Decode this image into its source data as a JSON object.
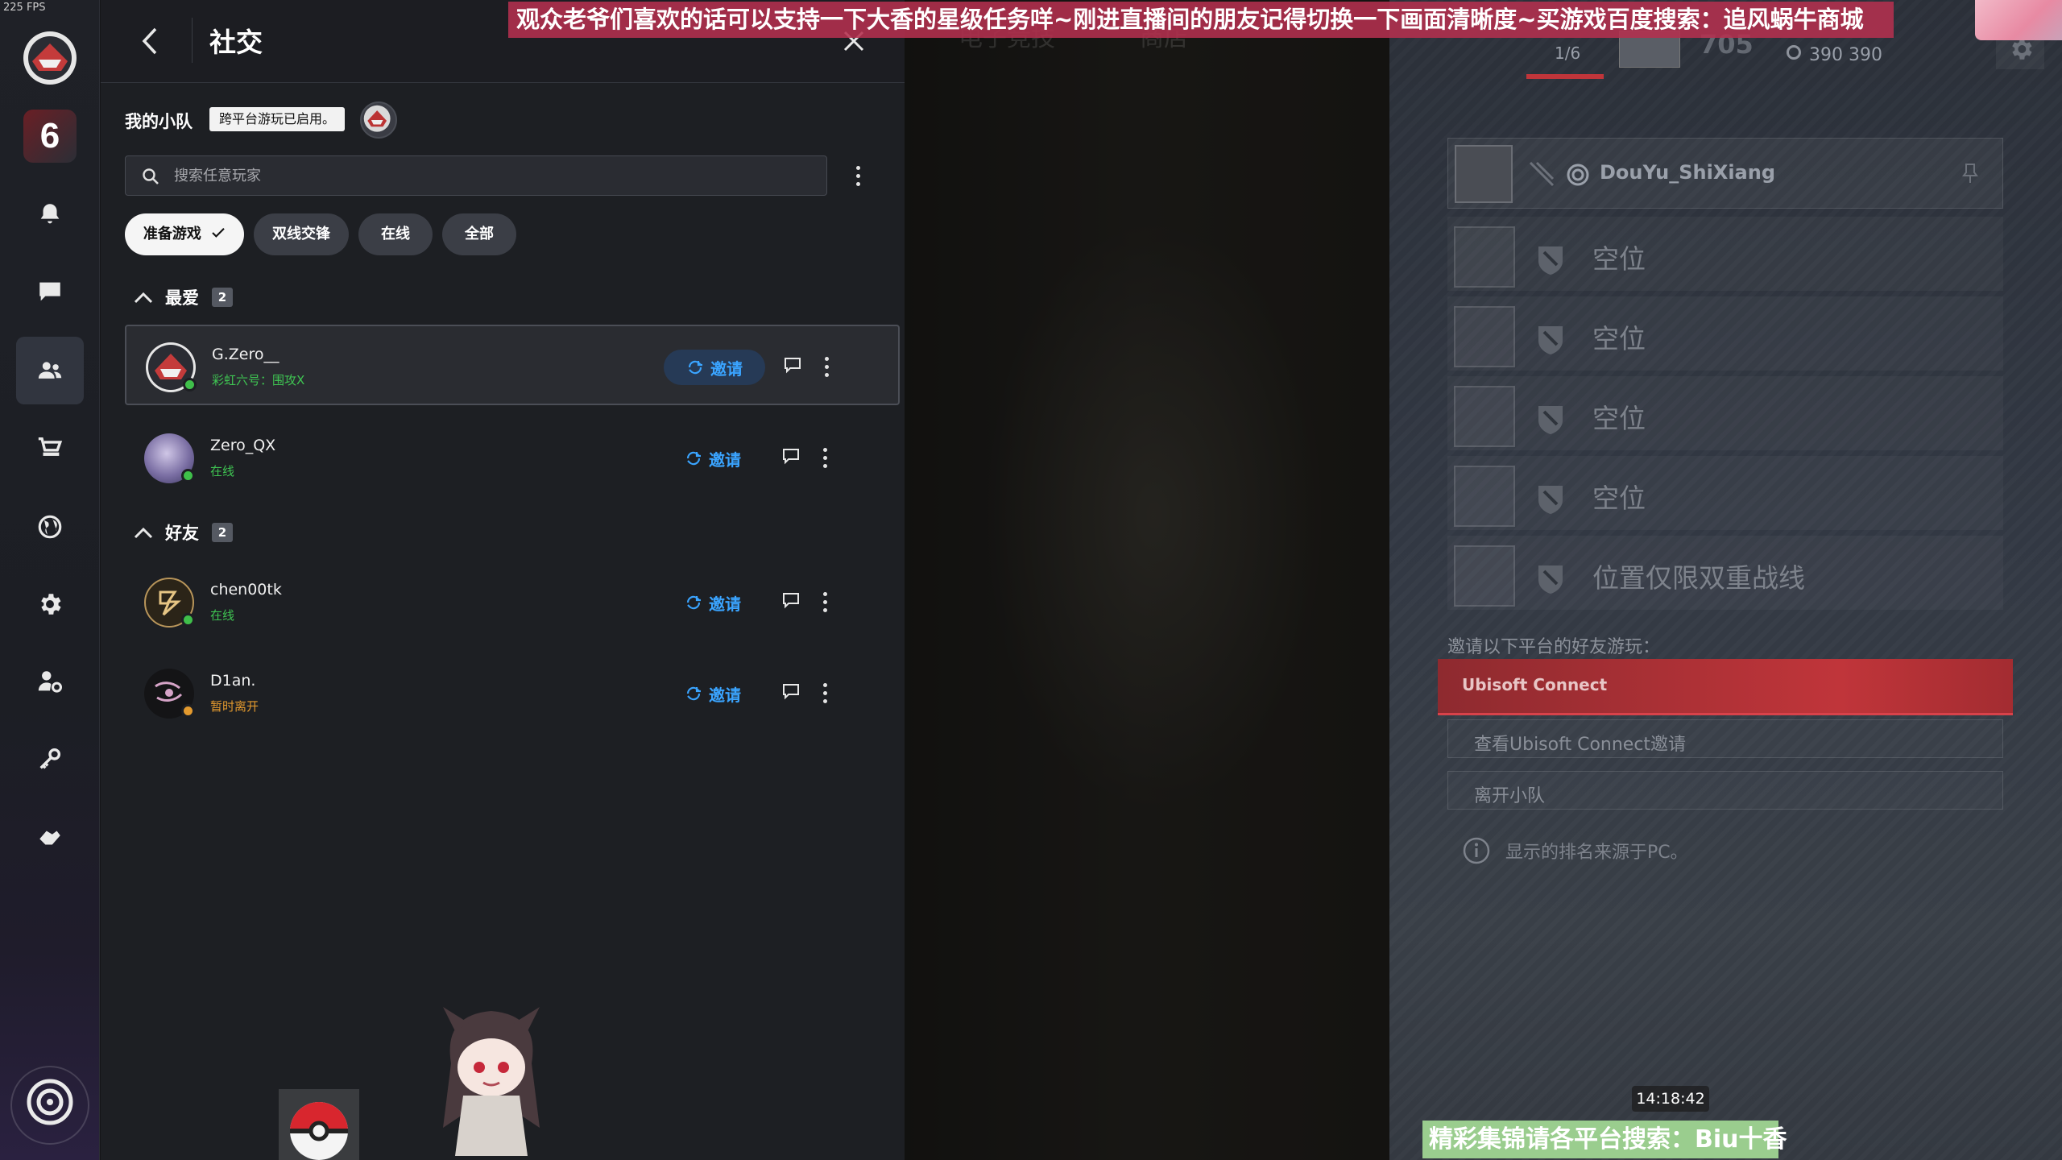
{
  "overlay": {
    "fps": "225 FPS",
    "top_banner": "观众老爷们喜欢的话可以支持一下大香的星级任务咩~刚进直播间的朋友记得切换一下画面清晰度~买游戏百度搜索：追风蜗牛商城",
    "bottom_banner": "精彩集锦请各平台搜索：Biu十香",
    "clock": "14:18:42"
  },
  "sidebar": {
    "game_tile": "6",
    "items": [
      {
        "name": "notifications-icon"
      },
      {
        "name": "chat-icon"
      },
      {
        "name": "friends-icon",
        "active": true
      },
      {
        "name": "store-icon"
      },
      {
        "name": "globe-icon"
      },
      {
        "name": "settings-icon"
      },
      {
        "name": "account-settings-icon"
      },
      {
        "name": "key-icon"
      },
      {
        "name": "hands-icon"
      }
    ]
  },
  "social": {
    "title": "社交",
    "my_squad": "我的小队",
    "crossplay_badge": "跨平台游玩已启用。",
    "search_placeholder": "搜索任意玩家",
    "filters": [
      {
        "label": "准备游戏",
        "selected": true
      },
      {
        "label": "双线交锋",
        "selected": false
      },
      {
        "label": "在线",
        "selected": false
      },
      {
        "label": "全部",
        "selected": false
      }
    ],
    "sections": [
      {
        "title": "最爱",
        "count": "2",
        "friends": [
          {
            "name": "G.Zero__",
            "status": "彩虹六号：围攻X",
            "presence": "online",
            "invite": "邀请"
          },
          {
            "name": "Zero_QX",
            "status": "在线",
            "presence": "online",
            "invite": "邀请"
          }
        ]
      },
      {
        "title": "好友",
        "count": "2",
        "friends": [
          {
            "name": "chen00tk",
            "status": "在线",
            "presence": "online",
            "invite": "邀请"
          },
          {
            "name": "D1an.",
            "status": "暂时离开",
            "presence": "away",
            "invite": "邀请"
          }
        ]
      }
    ]
  },
  "background": {
    "tabs": [
      "电子竞技",
      "商店"
    ],
    "squad_count": "1/6",
    "level": "705",
    "credits": "390 390",
    "party": {
      "player": "DouYu_ShiXiang",
      "slots": [
        "空位",
        "空位",
        "空位",
        "空位",
        "位置仅限双重战线"
      ]
    },
    "invite_platforms_label": "邀请以下平台的好友游玩：",
    "ubisoft_connect": "Ubisoft Connect",
    "view_invites": "查看Ubisoft Connect邀请",
    "leave_squad": "离开小队",
    "ranking_note": "显示的排名来源于PC。"
  },
  "colors": {
    "accent_invite": "#3aa4ff",
    "online": "#3fc452",
    "away": "#e49a2e",
    "ubisoft_red": "#c0353a"
  }
}
